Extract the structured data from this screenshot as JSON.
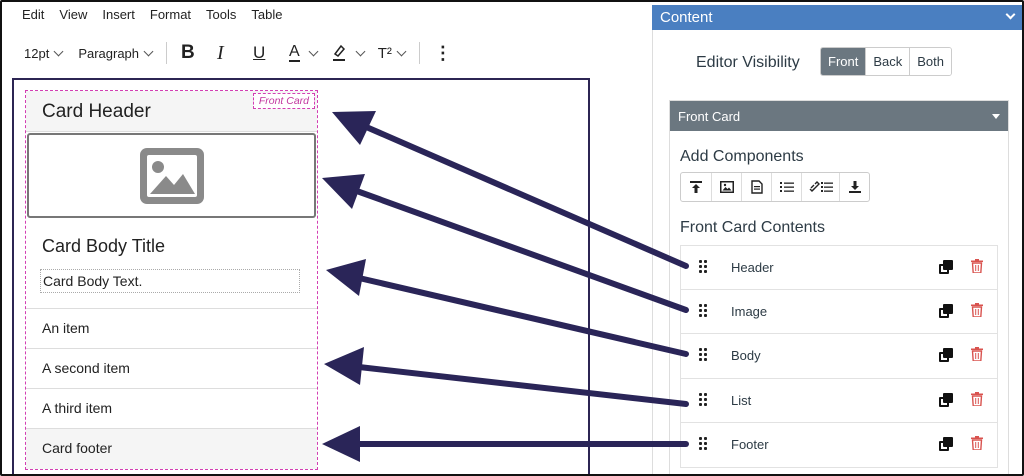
{
  "menu": [
    "Edit",
    "View",
    "Insert",
    "Format",
    "Tools",
    "Table"
  ],
  "toolbar": {
    "font_size": "12pt",
    "block_format": "Paragraph",
    "bold": "B",
    "italic": "I",
    "underline": "U",
    "text_color": "A",
    "superscript": "T²",
    "more": "⋮"
  },
  "card": {
    "tag": "Front Card",
    "header": "Card Header",
    "body_title": "Card Body Title",
    "body_text": "Card Body Text.",
    "items": [
      "An item",
      "A second item",
      "A third item"
    ],
    "footer": "Card footer"
  },
  "panel": {
    "title": "Content",
    "editor_visibility_label": "Editor Visibility",
    "visibility_options": [
      "Front",
      "Back",
      "Both"
    ],
    "visibility_selected": "Front",
    "section_title": "Front Card",
    "add_components_label": "Add Components",
    "contents_label": "Front Card Contents",
    "rows": [
      "Header",
      "Image",
      "Body",
      "List",
      "Footer"
    ]
  },
  "colors": {
    "panel_header": "#4a7fc1",
    "section_header": "#6b7780",
    "arrow": "#2a2558",
    "card_outline": "#d33fb3",
    "delete_icon": "#d9534f"
  }
}
